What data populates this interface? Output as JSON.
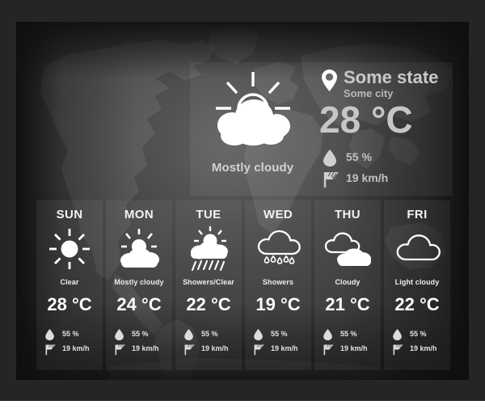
{
  "current": {
    "icon": "sun-behind-cloud-icon",
    "condition": "Mostly cloudy",
    "location_icon": "map-pin-icon",
    "state": "Some state",
    "city": "Some city",
    "temperature": "28 °C",
    "humidity_icon": "water-droplet-icon",
    "humidity": "55 %",
    "wind_icon": "wind-flag-icon",
    "wind": "19 km/h"
  },
  "forecast": [
    {
      "day": "SUN",
      "icon": "sun-icon",
      "condition": "Clear",
      "temperature": "28 °C",
      "humidity": "55 %",
      "wind": "19 km/h"
    },
    {
      "day": "MON",
      "icon": "sun-behind-cloud-icon",
      "condition": "Mostly cloudy",
      "temperature": "24 °C",
      "humidity": "55 %",
      "wind": "19 km/h"
    },
    {
      "day": "TUE",
      "icon": "sun-behind-rain-cloud-icon",
      "condition": "Showers/Clear",
      "temperature": "22 °C",
      "humidity": "55 %",
      "wind": "19 km/h"
    },
    {
      "day": "WED",
      "icon": "rain-cloud-outline-icon",
      "condition": "Showers",
      "temperature": "19 °C",
      "humidity": "55 %",
      "wind": "19 km/h"
    },
    {
      "day": "THU",
      "icon": "double-cloud-icon",
      "condition": "Cloudy",
      "temperature": "21 °C",
      "humidity": "55 %",
      "wind": "19 km/h"
    },
    {
      "day": "FRI",
      "icon": "cloud-outline-icon",
      "condition": "Light cloudy",
      "temperature": "22 °C",
      "humidity": "55 %",
      "wind": "19 km/h"
    }
  ],
  "theme": {
    "frame_color": "#262425",
    "stage_color": "#2a2829",
    "card_tint": "rgba(255,255,255,0.055)",
    "primary_text": "#f2f2f2",
    "secondary_text": "#c6c6c6",
    "icon_color": "#ffffff"
  }
}
